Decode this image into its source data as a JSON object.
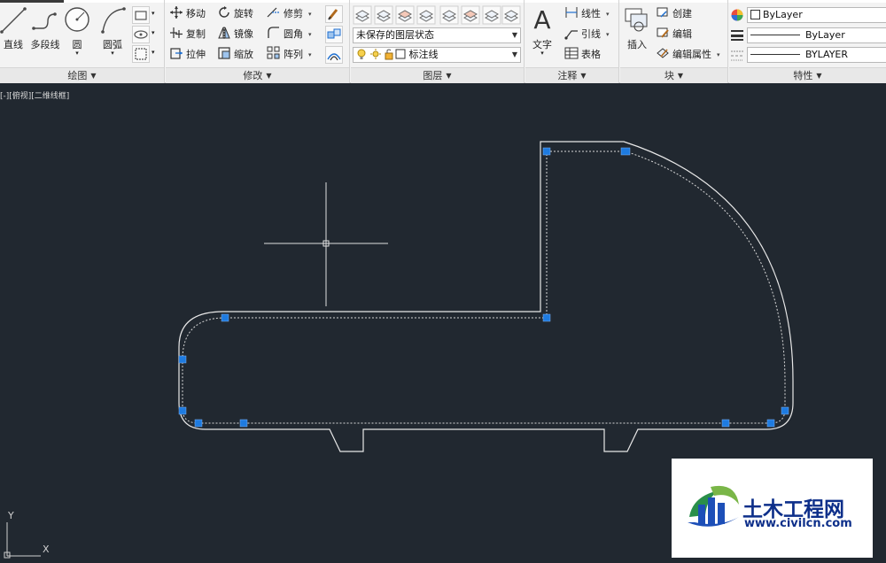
{
  "ribbon": {
    "draw_panel": {
      "title": "绘图",
      "line": "直线",
      "polyline": "多段线",
      "circle": "圆",
      "arc": "圆弧"
    },
    "modify_panel": {
      "title": "修改",
      "move": "移动",
      "rotate": "旋转",
      "trim": "修剪",
      "copy": "复制",
      "mirror": "镜像",
      "fillet": "圆角",
      "stretch": "拉伸",
      "scale": "缩放",
      "array": "阵列"
    },
    "layers_panel": {
      "title": "图层",
      "layer_state": "未保存的图层状态",
      "current_layer": "标注线"
    },
    "annotation_panel": {
      "title": "注释",
      "text": "文字",
      "linear": "线性",
      "leader": "引线",
      "table": "表格"
    },
    "block_panel": {
      "title": "块",
      "insert": "插入",
      "create": "创建",
      "edit": "编辑",
      "edit_attributes": "编辑属性"
    },
    "properties_panel": {
      "title": "特性",
      "color": "ByLayer",
      "lineweight": "ByLayer",
      "linetype": "BYLAYER"
    }
  },
  "viewport": {
    "label": "[-][俯视][二维线框]",
    "ucs_y": "Y",
    "ucs_x": "X"
  },
  "watermark": {
    "title": "土木工程网",
    "url": "www.civilcn.com"
  },
  "colors": {
    "canvas": "#212830",
    "grip": "#1e7be0",
    "line": "#ffffff",
    "ribbon": "#f3f3f3"
  }
}
